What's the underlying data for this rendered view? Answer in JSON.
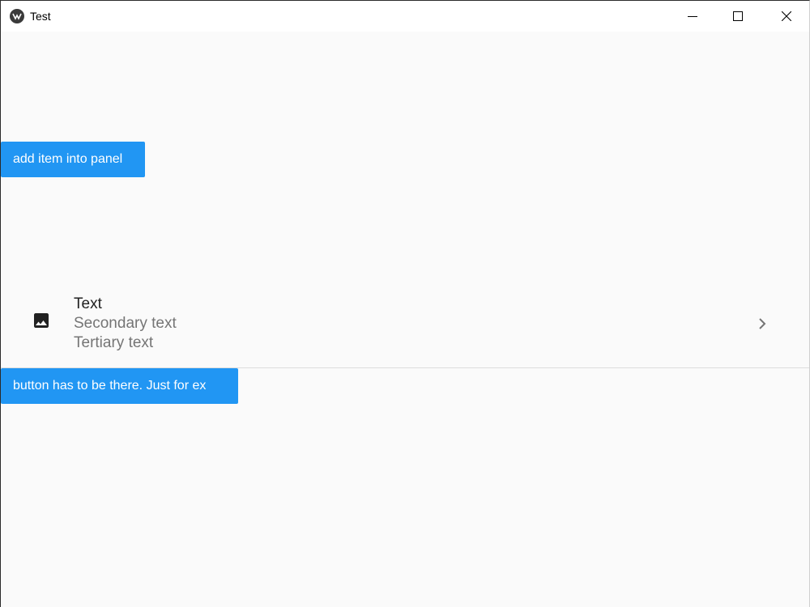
{
  "window": {
    "title": "Test",
    "app_icon": "kivy-logo-icon",
    "controls": [
      "minimize-icon",
      "maximize-icon",
      "close-icon"
    ]
  },
  "buttons": {
    "add_item": "add item into panel",
    "example": "button has to be there. Just for ex"
  },
  "list_item": {
    "icon": "image-icon",
    "primary": "Text",
    "secondary": "Secondary text",
    "tertiary": "Tertiary text",
    "trailing_icon": "chevron-right-icon"
  },
  "colors": {
    "accent": "#2196f3",
    "background": "#fafafa",
    "primary_text": "#212121",
    "secondary_text": "#757575"
  }
}
